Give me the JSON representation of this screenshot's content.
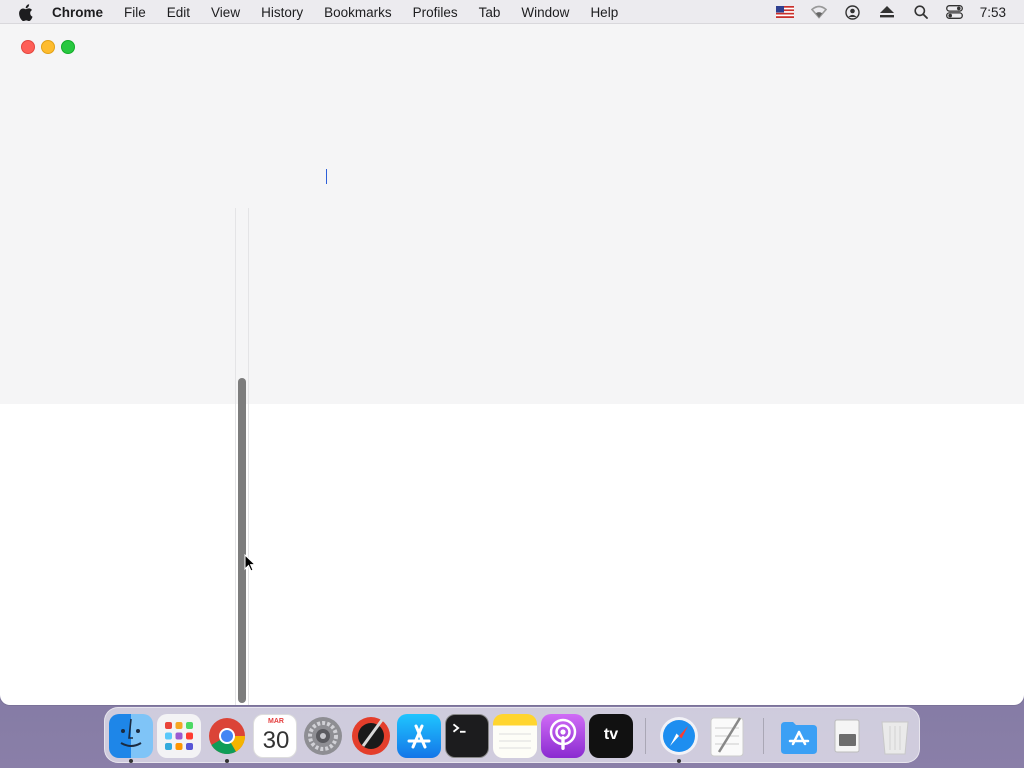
{
  "menubar": {
    "app_name": "Chrome",
    "items": [
      "File",
      "Edit",
      "View",
      "History",
      "Bookmarks",
      "Profiles",
      "Tab",
      "Window",
      "Help"
    ],
    "clock": "7:53",
    "status_icons": [
      "us-flag-input-icon",
      "wifi-icon",
      "user-account-icon",
      "eject-icon",
      "spotlight-search-icon",
      "control-center-icon"
    ]
  },
  "window": {
    "traffic_lights": [
      "close",
      "minimize",
      "zoom"
    ],
    "scrollbar_position": 0.55
  },
  "dock": {
    "apps": [
      {
        "name": "Finder",
        "running": true
      },
      {
        "name": "Launchpad",
        "running": false
      },
      {
        "name": "Google Chrome",
        "running": true
      },
      {
        "name": "Calendar",
        "running": false,
        "month": "MAR",
        "day": "30"
      },
      {
        "name": "System Preferences",
        "running": false
      },
      {
        "name": "Instruments",
        "running": false
      },
      {
        "name": "App Store",
        "running": false
      },
      {
        "name": "Terminal",
        "running": false
      },
      {
        "name": "Notes",
        "running": false
      },
      {
        "name": "Podcasts",
        "running": false
      },
      {
        "name": "TV",
        "running": false,
        "label": "tv"
      },
      {
        "name": "Safari",
        "running": true
      },
      {
        "name": "TextEdit",
        "running": false
      },
      {
        "name": "Downloads",
        "running": false
      },
      {
        "name": "Documents",
        "running": false
      },
      {
        "name": "Trash",
        "running": false
      }
    ]
  },
  "colors": {
    "close": "#fe5f57",
    "minimize": "#febc2e",
    "zoom": "#28c840",
    "caret": "#2d5fd8"
  }
}
